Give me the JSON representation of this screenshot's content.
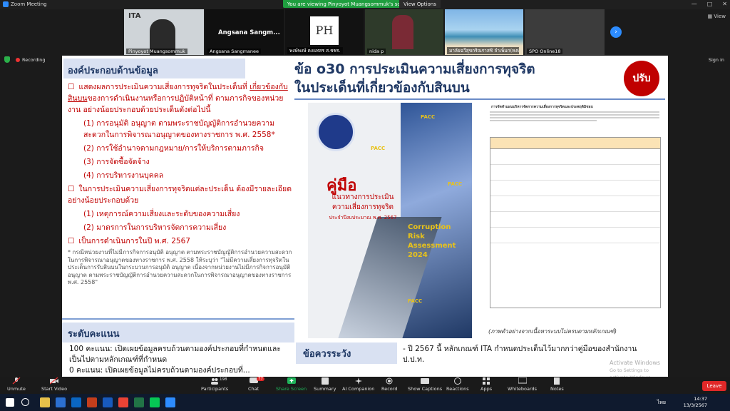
{
  "window": {
    "app_title": "Zoom Meeting",
    "viewing_banner": "You are viewing Pinyoyot Muangsommuk's screen",
    "view_options": "View Options"
  },
  "gallery": {
    "participants": [
      {
        "name": "Pinyoyot Muangsommuk"
      },
      {
        "name": "Angsana Sangmanee",
        "display": "Angsana  Sangm..."
      },
      {
        "name": "พงษ์พงษ์ คงแทสร ส.ชชร."
      },
      {
        "name": "nida p"
      },
      {
        "name": "มาลัยฉวีสุขกริณราสชิ ลำเพ็มก(หงษ์หิน"
      },
      {
        "name": "SPO Online18"
      }
    ],
    "view_label": "View",
    "tile1_logo": "ITA",
    "tile3_logo": "PH"
  },
  "status": {
    "recording": "Recording",
    "sign_in": "Sign in"
  },
  "slide": {
    "left_heading": "องค์ประกอบด้านข้อมูล",
    "right_title_line1": "ข้อ o30 การประเมินความเสี่ยงการทุจริต",
    "right_title_line2": "ในประเด็นที่เกี่ยวข้องกับสินบน",
    "ribbon": "ปรับ",
    "item1_a": "แสดงผลการประเมินความเสี่ยงการทุจริตในประเด็นที่ ",
    "item1_b": "เกี่ยวข้องกับสินบน",
    "item1_c": "ของการดำเนินงานหรือการปฏิบัติหน้าที่ ตามภารกิจของหน่วยงาน อย่างน้อยประกอบด้วยประเด็นดังต่อไปนี้",
    "sub1": "(1) การอนุมัติ อนุญาต ตามพระราชบัญญัติการอำนวยความสะดวกในการพิจารณาอนุญาตของทางราชการ พ.ศ. 2558*",
    "sub2": "(2) การใช้อำนาจตามกฎหมาย/การให้บริการตามภารกิจ",
    "sub3": "(3) การจัดซื้อจัดจ้าง",
    "sub4": "(4) การบริหารงานบุคคล",
    "item2": "ในการประเมินความเสี่ยงการทุจริตแต่ละประเด็น ต้องมีรายละเอียด อย่างน้อยประกอบด้วย",
    "sub5": "(1) เหตุการณ์ความเสี่ยงและระดับของความเสี่ยง",
    "sub6": "(2) มาตรการในการบริหารจัดการความเสี่ยง",
    "item3": "เป็นการดำเนินการในปี พ.ศ. 2567",
    "note": "* กรณีหน่วยงานที่ไม่มีภารกิจการอนุมัติ อนุญาต ตามพระราชบัญญัติการอำนวยความสะดวกในการพิจารณาอนุญาตของทางราชการ พ.ศ. 2558 ให้ระบุว่า \"ไม่มีความเสี่ยงการทุจริตในประเด็นการรับสินบนในกระบวนการอนุมัติ อนุญาต เนื่องจากหน่วยงานไม่มีภารกิจการอนุมัติ อนุญาต ตามพระราชบัญญัติการอำนวยความสะดวกในการพิจารณาอนุญาตของทางราชการ พ.ศ. 2558\"",
    "score_heading": "ระดับคะแนน",
    "score_100": "100 คะแนน: เปิดเผยข้อมูลครบถ้วนตามองค์ประกอบที่กำหนดและเป็นไปตามหลักเกณฑ์ที่กำหนด",
    "score_0": "0 คะแนน: เปิดเผยข้อมูลไม่ครบถ้วนตามองค์ประกอบที่...",
    "book_title": "คู่มือ",
    "book_sub1": "แนวทางการประเมิน",
    "book_sub2": "ความเสี่ยงการทุจริต",
    "book_sub3": "ประจำปีงบประมาณ พ.ศ. 2567",
    "book_cra1": "Corruption",
    "book_cra2": "Risk",
    "book_cra3": "Assessment",
    "book_cra4": "2024",
    "book_pacc": "PACC",
    "doc_title": "การจัดทำแผนบริหารจัดการความเสี่ยงการทุจริตและประพฤติมิชอบ",
    "doc_caption": "(ภาพตัวอย่างจากเนื้อหาระบบไม่ครบตามหลักเกณฑ์)",
    "tip_heading": "ข้อควรระวัง",
    "tip_text": "- ปี 2567 นี้ หลักเกณฑ์ ITA กำหนดประเด็นไว้มากกว่าคู่มือของสำนักงาน ป.ป.ท.",
    "activate": "Activate Windows",
    "activate2": "Go to Settings to activate Windows."
  },
  "toolbar": {
    "unmute": "Unmute",
    "start_video": "Start Video",
    "participants": "Participants",
    "participants_count": "198",
    "chat": "Chat",
    "chat_badge": "77",
    "share": "Share Screen",
    "summary": "Summary",
    "ai": "AI Companion",
    "record": "Record",
    "cc": "Show Captions",
    "reactions": "Reactions",
    "apps": "Apps",
    "whiteboards": "Whiteboards",
    "notes": "Notes",
    "leave": "Leave"
  },
  "taskbar": {
    "time": "14:37",
    "date": "13/3/2567",
    "lang": "ไทย"
  }
}
